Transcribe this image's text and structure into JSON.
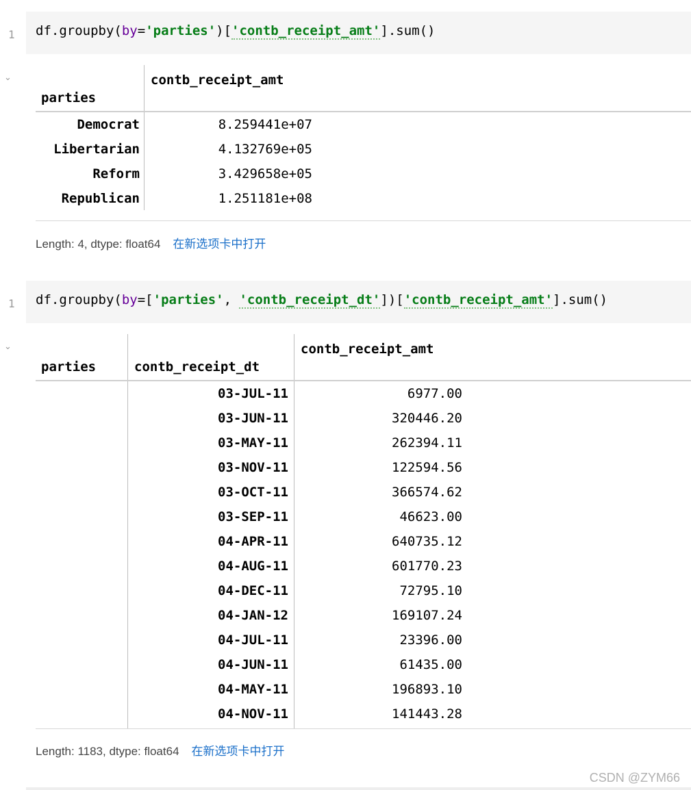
{
  "cell1": {
    "line_no": "1",
    "code": {
      "p1": "df.groupby(",
      "kw": "by",
      "p2": "=",
      "s1": "'parties'",
      "p3": ")[",
      "s2": "'contb_receipt_amt'",
      "p4": "].sum()"
    },
    "output": {
      "index_header": "parties",
      "col_header": "contb_receipt_amt",
      "rows": [
        {
          "idx": "Democrat",
          "val": "8.259441e+07"
        },
        {
          "idx": "Libertarian",
          "val": "4.132769e+05"
        },
        {
          "idx": "Reform",
          "val": "3.429658e+05"
        },
        {
          "idx": "Republican",
          "val": "1.251181e+08"
        }
      ],
      "meta": "Length: 4, dtype: float64",
      "link": "在新选项卡中打开"
    }
  },
  "cell2": {
    "line_no": "1",
    "code": {
      "p1": "df.groupby(",
      "kw": "by",
      "p2": "=[",
      "s1": "'parties'",
      "p3": ", ",
      "s2": "'contb_receipt_dt'",
      "p4": "])[",
      "s3": "'contb_receipt_amt'",
      "p5": "].sum()"
    },
    "output": {
      "index_header_1": "parties",
      "index_header_2": "contb_receipt_dt",
      "col_header": "contb_receipt_amt",
      "rows": [
        {
          "idx": "03-JUL-11",
          "val": "6977.00"
        },
        {
          "idx": "03-JUN-11",
          "val": "320446.20"
        },
        {
          "idx": "03-MAY-11",
          "val": "262394.11"
        },
        {
          "idx": "03-NOV-11",
          "val": "122594.56"
        },
        {
          "idx": "03-OCT-11",
          "val": "366574.62"
        },
        {
          "idx": "03-SEP-11",
          "val": "46623.00"
        },
        {
          "idx": "04-APR-11",
          "val": "640735.12"
        },
        {
          "idx": "04-AUG-11",
          "val": "601770.23"
        },
        {
          "idx": "04-DEC-11",
          "val": "72795.10"
        },
        {
          "idx": "04-JAN-12",
          "val": "169107.24"
        },
        {
          "idx": "04-JUL-11",
          "val": "23396.00"
        },
        {
          "idx": "04-JUN-11",
          "val": "61435.00"
        },
        {
          "idx": "04-MAY-11",
          "val": "196893.10"
        },
        {
          "idx": "04-NOV-11",
          "val": "141443.28"
        }
      ],
      "meta": "Length: 1183, dtype: float64",
      "link": "在新选项卡中打开"
    }
  },
  "watermark": "CSDN @ZYM66",
  "colors": {
    "string": "#067d17",
    "keyword": "#660099",
    "link": "#1a6fc9",
    "cell_bg": "#f5f5f5"
  }
}
